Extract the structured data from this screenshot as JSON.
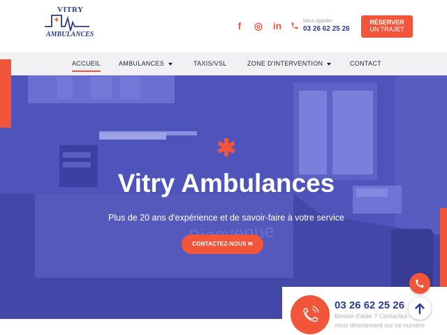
{
  "brand": {
    "logo_top": "VITRY",
    "logo_bottom": "AMBULANCES"
  },
  "header": {
    "social": [
      {
        "name": "facebook-icon",
        "glyph": "f"
      },
      {
        "name": "instagram-icon",
        "glyph": "◎"
      },
      {
        "name": "linkedin-icon",
        "glyph": "in"
      }
    ],
    "phone_caption": "Nous appeler",
    "phone_number": "03 26 62 25 26",
    "reserve_line1": "RÉSERVER",
    "reserve_line2": "UN TRAJET"
  },
  "nav": {
    "items": [
      {
        "label": "ACCUEIL",
        "active": true
      },
      {
        "label": "AMBULANCES",
        "dropdown": true
      },
      {
        "label": "TAXIS/VSL"
      },
      {
        "label": "ZONE D'INTERVENTION",
        "dropdown": true
      },
      {
        "label": "CONTACT"
      }
    ]
  },
  "hero": {
    "title": "Vitry Ambulances",
    "subtitle": "Plus de 20 ans d'expérience et de savoir-faire à votre service",
    "cta": "CONTACTEZ-NOUS ✉",
    "background_sign": "Bienvenue"
  },
  "call_widget": {
    "number": "03 26 62 25 26",
    "help_line1": "Besoin d'aide ? Contactez-",
    "help_line2": "nous directement sur ce numéro"
  },
  "colors": {
    "accent": "#f2563a",
    "brand_blue": "#2a3a8f",
    "hero_overlay": "#4a4fb6"
  }
}
